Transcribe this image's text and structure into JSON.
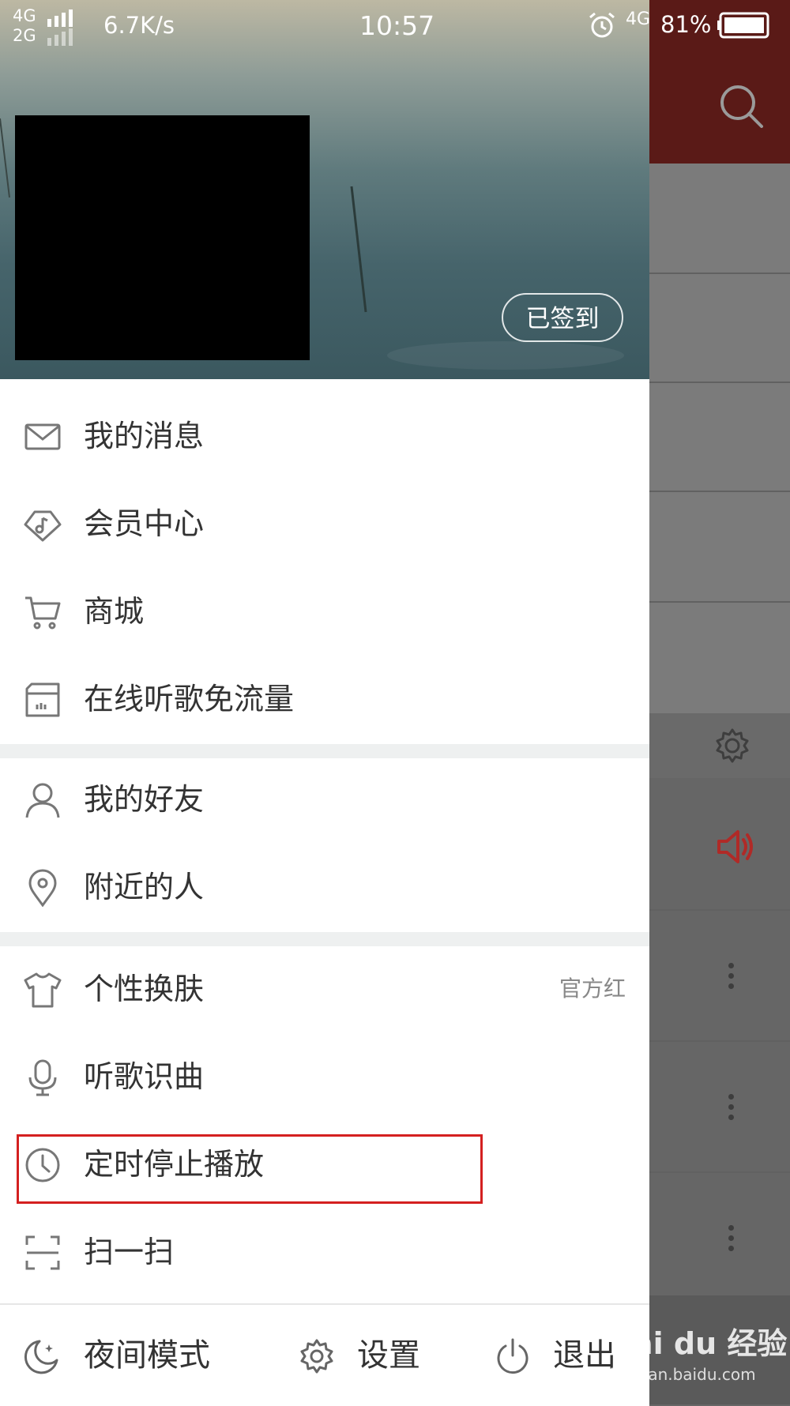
{
  "status_bar": {
    "network_line1": "4G",
    "network_line2": "2G",
    "speed": "6.7K/s",
    "time": "10:57",
    "network_right": "4G",
    "battery": "81%"
  },
  "profile": {
    "checkin_label": "已签到"
  },
  "menu": {
    "group1": [
      {
        "label": "我的消息",
        "icon": "mail-icon"
      },
      {
        "label": "会员中心",
        "icon": "diamond-music-icon"
      },
      {
        "label": "商城",
        "icon": "cart-icon"
      },
      {
        "label": "在线听歌免流量",
        "icon": "sim-card-icon"
      }
    ],
    "group2": [
      {
        "label": "我的好友",
        "icon": "user-icon"
      },
      {
        "label": "附近的人",
        "icon": "location-pin-icon"
      }
    ],
    "group3": [
      {
        "label": "个性换肤",
        "icon": "tshirt-icon",
        "value": "官方红"
      },
      {
        "label": "听歌识曲",
        "icon": "microphone-icon"
      },
      {
        "label": "定时停止播放",
        "icon": "clock-icon"
      },
      {
        "label": "扫一扫",
        "icon": "scan-icon"
      }
    ]
  },
  "footer": {
    "night_mode": "夜间模式",
    "settings": "设置",
    "exit": "退出"
  },
  "watermark": {
    "brand": "Bai du 经验",
    "url": "jingyan.baidu.com"
  },
  "colors": {
    "accent_red": "#c62f2f",
    "highlight_box": "#d42020",
    "topbar_dim": "#5a1a17"
  }
}
